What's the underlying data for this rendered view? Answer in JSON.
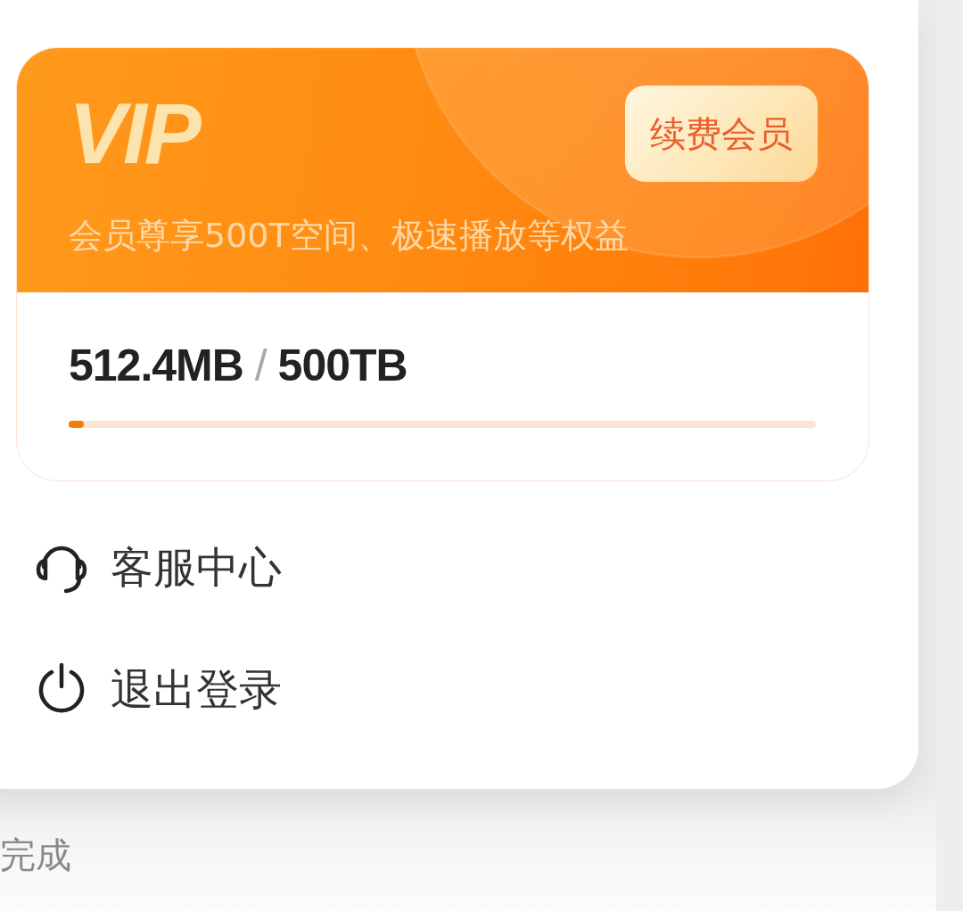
{
  "vip_card": {
    "badge": "VIP",
    "renew_button": "续费会员",
    "benefits": "会员尊享500T空间、极速播放等权益",
    "usage": {
      "used": "512.4MB",
      "separator": "/",
      "total": "500TB",
      "level": 0.02
    }
  },
  "menu": [
    {
      "kind": "support",
      "label": "客服中心"
    },
    {
      "kind": "logout",
      "label": "退出登录"
    }
  ],
  "footer": {
    "done_button": "完成"
  }
}
